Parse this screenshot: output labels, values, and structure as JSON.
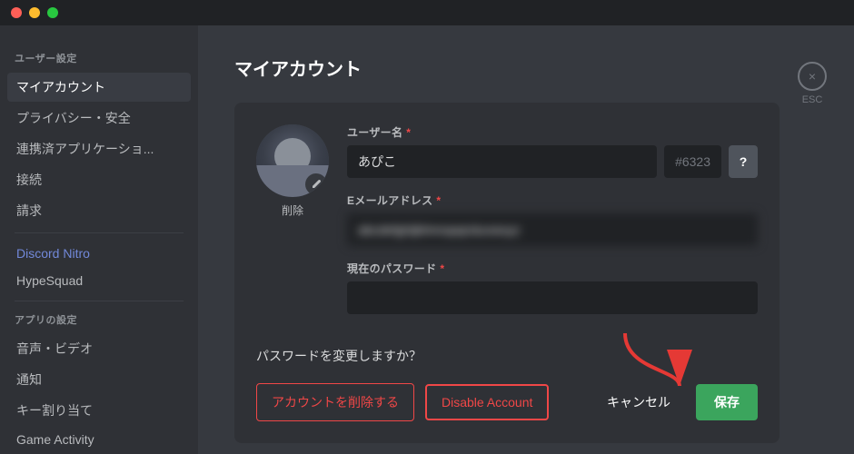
{
  "titlebar": {
    "btn_close": "close",
    "btn_minimize": "minimize",
    "btn_maximize": "maximize"
  },
  "sidebar": {
    "user_settings_label": "ユーザー設定",
    "items": [
      {
        "id": "my-account",
        "label": "マイアカウント",
        "active": true
      },
      {
        "id": "privacy-safety",
        "label": "プライバシー・安全"
      },
      {
        "id": "authorized-apps",
        "label": "連携済アプリケーショ..."
      },
      {
        "id": "connections",
        "label": "接続"
      },
      {
        "id": "billing",
        "label": "請求"
      }
    ],
    "nitro_items": [
      {
        "id": "discord-nitro",
        "label": "Discord Nitro",
        "nitro": true
      },
      {
        "id": "hypesquad",
        "label": "HypeSquad"
      }
    ],
    "app_settings_label": "アプリの設定",
    "app_items": [
      {
        "id": "voice-video",
        "label": "音声・ビデオ"
      },
      {
        "id": "notifications",
        "label": "通知"
      },
      {
        "id": "keybinds",
        "label": "キー割り当て"
      },
      {
        "id": "game-activity",
        "label": "Game Activity"
      }
    ]
  },
  "main": {
    "page_title": "マイアカウント",
    "username_label": "ユーザー名",
    "username_value": "あぴこ",
    "discriminator": "#6323",
    "help_btn_label": "?",
    "email_label": "Eメールアドレス",
    "email_placeholder": "●●●●●●●●●●●●●●●●●●●●",
    "password_label": "現在のパスワード",
    "password_placeholder": "",
    "change_pw_text": "パスワードを変更しますか？",
    "avatar_delete_label": "削除",
    "actions": {
      "delete_account": "アカウントを削除する",
      "disable_account": "Disable Account",
      "cancel": "キャンセル",
      "save": "保存"
    }
  },
  "esc": {
    "x_label": "×",
    "label": "ESC"
  }
}
